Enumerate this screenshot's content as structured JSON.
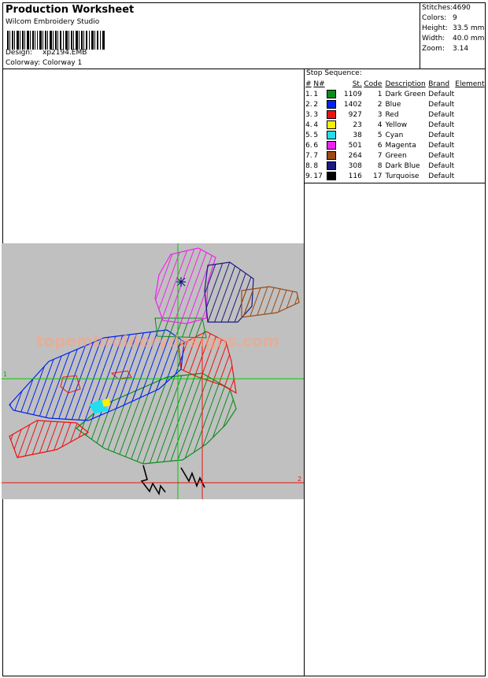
{
  "header": {
    "title": "Production Worksheet",
    "software": "Wilcom  Embroidery Studio",
    "design_label": "Design:",
    "design_value": "xp2194.EMB",
    "colorway_label": "Colorway:",
    "colorway_value": "Colorway 1"
  },
  "stats": [
    {
      "label": "Stitches:",
      "value": "4690"
    },
    {
      "label": "Colors:",
      "value": "9"
    },
    {
      "label": "Height:",
      "value": "33.5 mm"
    },
    {
      "label": "Width:",
      "value": "40.0 mm"
    },
    {
      "label": "Zoom:",
      "value": "3.14"
    }
  ],
  "sequence": {
    "title": "Stop Sequence:",
    "columns": [
      "#",
      "N#",
      "St.",
      "Code",
      "Description",
      "Brand",
      "Element"
    ],
    "rows": [
      {
        "idx": "1.",
        "n": "1",
        "color": "#0a8c1e",
        "st": "1109",
        "code": "1",
        "desc": "Dark Green",
        "brand": "Default"
      },
      {
        "idx": "2.",
        "n": "2",
        "color": "#0022ee",
        "st": "1402",
        "code": "2",
        "desc": "Blue",
        "brand": "Default"
      },
      {
        "idx": "3.",
        "n": "3",
        "color": "#ee1111",
        "st": "927",
        "code": "3",
        "desc": "Red",
        "brand": "Default"
      },
      {
        "idx": "4.",
        "n": "4",
        "color": "#ffee00",
        "st": "23",
        "code": "4",
        "desc": "Yellow",
        "brand": "Default"
      },
      {
        "idx": "5.",
        "n": "5",
        "color": "#22ddee",
        "st": "38",
        "code": "5",
        "desc": "Cyan",
        "brand": "Default"
      },
      {
        "idx": "6.",
        "n": "6",
        "color": "#ee22ee",
        "st": "501",
        "code": "6",
        "desc": "Magenta",
        "brand": "Default"
      },
      {
        "idx": "7.",
        "n": "7",
        "color": "#9a4a14",
        "st": "264",
        "code": "7",
        "desc": "Green",
        "brand": "Default"
      },
      {
        "idx": "8.",
        "n": "8",
        "color": "#1a1a80",
        "st": "308",
        "code": "8",
        "desc": "Dark Blue",
        "brand": "Default"
      },
      {
        "idx": "9.",
        "n": "17",
        "color": "#000000",
        "st": "116",
        "code": "17",
        "desc": "Turquoise",
        "brand": "Default"
      }
    ]
  },
  "canvas": {
    "watermark": "topembroiderydesigns.com",
    "marker_1": "1",
    "marker_2": "2"
  }
}
